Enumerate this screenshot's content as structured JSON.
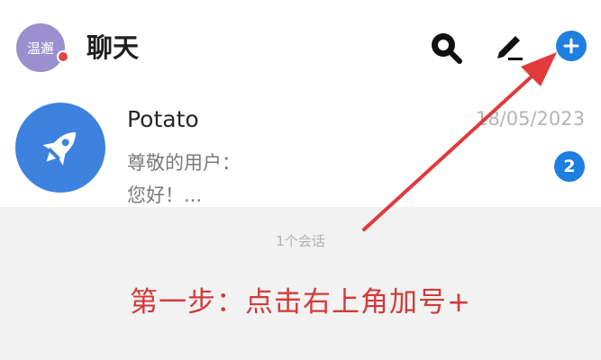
{
  "header": {
    "avatar_text": "温邂",
    "title": "聊天",
    "icons": {
      "search": "search-icon",
      "edit": "pencil-icon",
      "add": "plus-icon"
    }
  },
  "chat": {
    "name": "Potato",
    "date": "18/05/2023",
    "preview_line1": "尊敬的用户：",
    "preview_line2": "您好！...",
    "unread": "2",
    "avatar_icon": "rocket-icon"
  },
  "footer": {
    "count": "1个会话",
    "instruction": "第一步：点击右上角加号+"
  },
  "colors": {
    "accent": "#1e7fe0",
    "annotation": "#d33a3a",
    "avatar": "#9b8fd0",
    "chat_avatar": "#3e82e0"
  }
}
